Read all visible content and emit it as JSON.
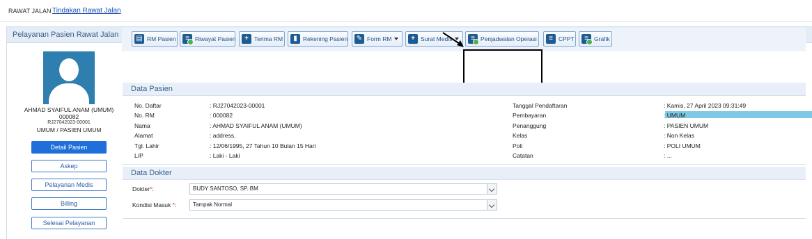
{
  "breadcrumb": {
    "root": "RAWAT JALAN",
    "current": "Tindakan Rawat Jalan"
  },
  "panel": {
    "title": "Pelayanan Pasien Rawat Jalan"
  },
  "profile": {
    "name": "AHMAD SYAIFUL ANAM (UMUM)",
    "rm": "000082",
    "reg": "RJ27042023-00001",
    "group": "UMUM / PASIEN UMUM"
  },
  "side_menu": [
    "Detail Pasien",
    "Askep",
    "Pelayanan Medis",
    "Billing",
    "Selesai Pelayanan"
  ],
  "toolbar": [
    {
      "label": "RM Pasien",
      "icon": "clipboard-icon"
    },
    {
      "label": "Riwayat Pasien",
      "icon": "history-doc-icon"
    },
    {
      "label": "Terima RM",
      "icon": "plus-icon"
    },
    {
      "label": "Rekening Pasien",
      "icon": "account-icon"
    },
    {
      "label": "Form RM",
      "icon": "form-edit-icon"
    },
    {
      "label": "Surat Medis",
      "icon": "medical-letter-icon"
    },
    {
      "label": "Penjadwalan Operasi",
      "icon": "schedule-doc-icon"
    },
    {
      "label": "CPPT",
      "icon": "notes-icon"
    },
    {
      "label": "Grafik",
      "icon": "chart-doc-icon"
    }
  ],
  "data_pasien": {
    "title": "Data Pasien",
    "left": [
      {
        "label": "No. Daftar",
        "value": ": RJ27042023-00001"
      },
      {
        "label": "No. RM",
        "value": ": 000082"
      },
      {
        "label": "Nama",
        "value": ": AHMAD SYAIFUL ANAM (UMUM)"
      },
      {
        "label": "Alamat",
        "value": ": address,"
      },
      {
        "label": "Tgl. Lahir",
        "value": ": 12/06/1995, 27 Tahun 10 Bulan 15 Hari"
      },
      {
        "label": "L/P",
        "value": ": Laki - Laki"
      }
    ],
    "right": [
      {
        "label": "Tanggal Pendaftaran",
        "value": ": Kamis, 27 April 2023 09:31:49"
      },
      {
        "label": "Pembayaran",
        "value": ": UMUM"
      },
      {
        "label": "Penanggung",
        "value": ": PASIEN UMUM"
      },
      {
        "label": "Kelas",
        "value": ": Non Kelas"
      },
      {
        "label": "Poli",
        "value": ": POLI UMUM"
      },
      {
        "label": "Catatan",
        "value": ": ..."
      }
    ]
  },
  "data_dokter": {
    "title": "Data Dokter",
    "dokter_label": "Dokter",
    "dokter_value": "BUDY SANTOSO, SP. BM",
    "kondisi_label": "Kondisi Masuk ",
    "kondisi_value": "Tampak Normal",
    "required_mark": "*",
    "colon": ":"
  },
  "colors": {
    "accent": "#1e6fd9",
    "highlight": "#7ec9e6",
    "header_bg": "#e4edf7"
  }
}
